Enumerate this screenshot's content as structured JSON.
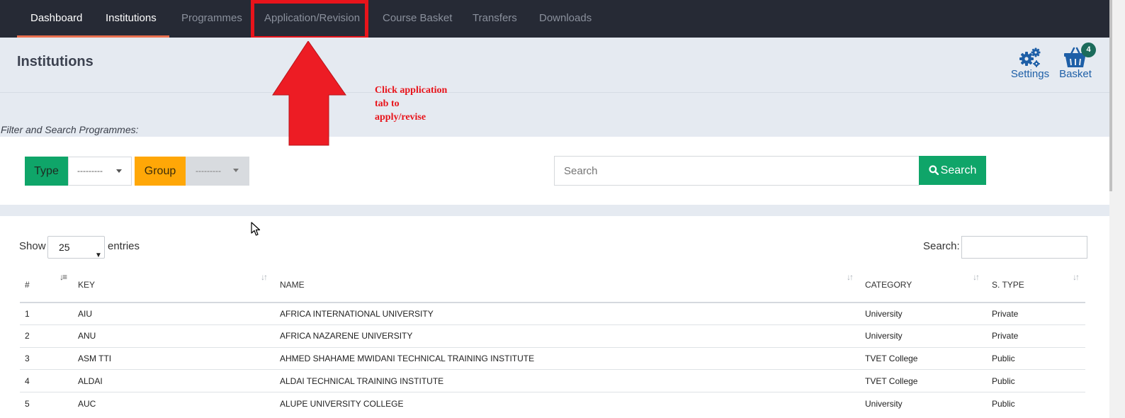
{
  "nav": {
    "items": [
      {
        "label": "Dashboard",
        "active": true
      },
      {
        "label": "Institutions",
        "active": true
      },
      {
        "label": "Programmes",
        "active": false
      },
      {
        "label": "Application/Revision",
        "active": false
      },
      {
        "label": "Course Basket",
        "active": false
      },
      {
        "label": "Transfers",
        "active": false
      },
      {
        "label": "Downloads",
        "active": false
      }
    ]
  },
  "header": {
    "title": "Institutions",
    "settings_label": "Settings",
    "basket_label": "Basket",
    "basket_count": "4"
  },
  "annotation": {
    "text_line1": "Click application",
    "text_line2": "tab to",
    "text_line3": "apply/revise"
  },
  "filter": {
    "label": "Filter and Search Programmes:",
    "type_label": "Type",
    "type_value": "---------",
    "group_label": "Group",
    "group_value": "---------",
    "search_placeholder": "Search",
    "search_button": "Search"
  },
  "table_controls": {
    "show_label": "Show",
    "entries_value": "25",
    "entries_label": "entries",
    "search_label": "Search:"
  },
  "table": {
    "columns": [
      "#",
      "KEY",
      "NAME",
      "CATEGORY",
      "S. TYPE"
    ],
    "rows": [
      {
        "num": "1",
        "key": "AIU",
        "name": "AFRICA INTERNATIONAL UNIVERSITY",
        "category": "University",
        "stype": "Private"
      },
      {
        "num": "2",
        "key": "ANU",
        "name": "AFRICA NAZARENE UNIVERSITY",
        "category": "University",
        "stype": "Private"
      },
      {
        "num": "3",
        "key": "ASM TTI",
        "name": "AHMED SHAHAME MWIDANI TECHNICAL TRAINING INSTITUTE",
        "category": "TVET College",
        "stype": "Public"
      },
      {
        "num": "4",
        "key": "ALDAI",
        "name": "ALDAI TECHNICAL TRAINING INSTITUTE",
        "category": "TVET College",
        "stype": "Public"
      },
      {
        "num": "5",
        "key": "AUC",
        "name": "ALUPE UNIVERSITY COLLEGE",
        "category": "University",
        "stype": "Public"
      }
    ]
  },
  "colors": {
    "nav_bg": "#262a35",
    "accent_green": "#0fa569",
    "accent_orange": "#ffa707",
    "annotation_red": "#e8141b",
    "link_blue": "#1e5fa7"
  }
}
